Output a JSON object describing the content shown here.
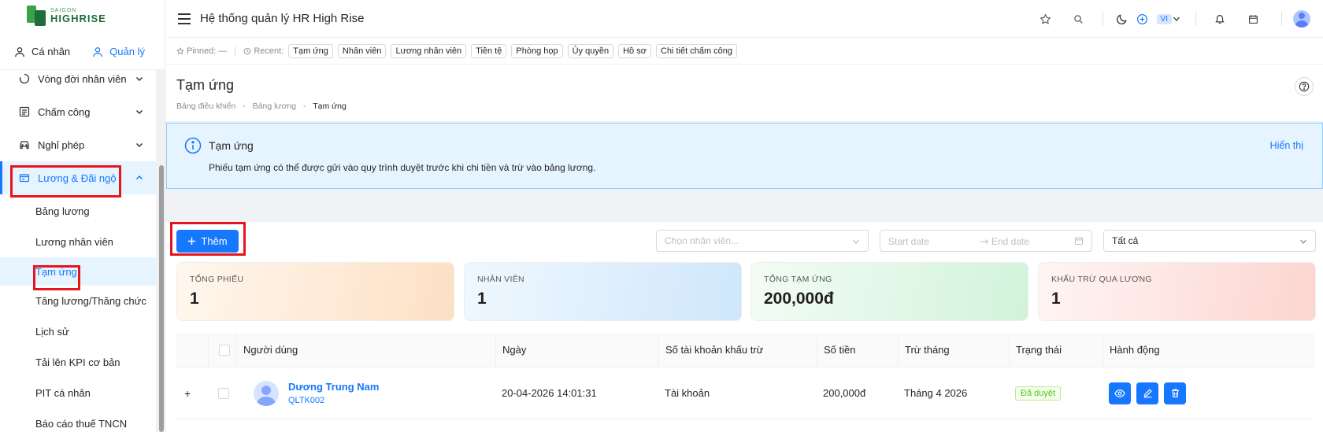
{
  "brand": {
    "small": "SAIGON",
    "big": "HIGHRISE"
  },
  "mode_switch": {
    "personal": "Cá nhân",
    "manage": "Quản lý"
  },
  "menu": {
    "items": [
      {
        "label": "Vòng đời nhân viên"
      },
      {
        "label": "Chấm công"
      },
      {
        "label": "Nghỉ phép"
      },
      {
        "label": "Lương & Đãi ngộ"
      }
    ],
    "submenu": [
      {
        "label": "Bảng lương"
      },
      {
        "label": "Lương nhân viên"
      },
      {
        "label": "Tạm ứng"
      },
      {
        "label": "Tăng lương/Thăng chức"
      },
      {
        "label": "Lịch sử"
      },
      {
        "label": "Tải lên KPI cơ bản"
      },
      {
        "label": "PIT cá nhân"
      },
      {
        "label": "Báo cáo thuế TNCN"
      }
    ]
  },
  "topbar": {
    "title": "Hệ thống quản lý HR High Rise",
    "lang": "VI"
  },
  "recent": {
    "pinned_label": "Pinned:",
    "pinned_value": "—",
    "recent_label": "Recent:",
    "chips": [
      "Tạm ứng",
      "Nhân viên",
      "Lương nhân viên",
      "Tiền tệ",
      "Phòng họp",
      "Ủy quyền",
      "Hồ sơ",
      "Chi tiết chấm công"
    ]
  },
  "page": {
    "title": "Tạm ứng",
    "breadcrumb": [
      "Bảng điều khiển",
      "Bảng lương",
      "Tạm ứng"
    ],
    "breadcrumb_sep": "-"
  },
  "alert": {
    "title": "Tạm ứng",
    "desc": "Phiếu tạm ứng có thể được gửi vào quy trình duyệt trước khi chi tiền và trừ vào bảng lương.",
    "action": "Hiển thị"
  },
  "toolbar": {
    "add_label": "Thêm",
    "employee_placeholder": "Chọn nhân viên...",
    "start_placeholder": "Start date",
    "end_placeholder": "End date",
    "status_value": "Tất cả"
  },
  "stats": [
    {
      "label": "TỔNG PHIẾU",
      "value": "1"
    },
    {
      "label": "NHÂN VIÊN",
      "value": "1"
    },
    {
      "label": "TỔNG TẠM ỨNG",
      "value": "200,000đ"
    },
    {
      "label": "KHẤU TRỪ QUA LƯƠNG",
      "value": "1"
    }
  ],
  "table": {
    "columns": [
      "Người dùng",
      "Ngày",
      "Số tài khoản khấu trừ",
      "Số tiền",
      "Trừ tháng",
      "Trạng thái",
      "Hành động"
    ],
    "rows": [
      {
        "expand": "+",
        "name": "Dương Trung Nam",
        "code": "QLTK002",
        "date": "20-04-2026 14:01:31",
        "account": "Tài khoản",
        "amount": "200,000đ",
        "month": "Tháng 4 2026",
        "status": "Đã duyệt"
      }
    ]
  },
  "colors": {
    "primary": "#1677ff",
    "highlight_border": "#e8141b",
    "success": "#52c41a"
  }
}
